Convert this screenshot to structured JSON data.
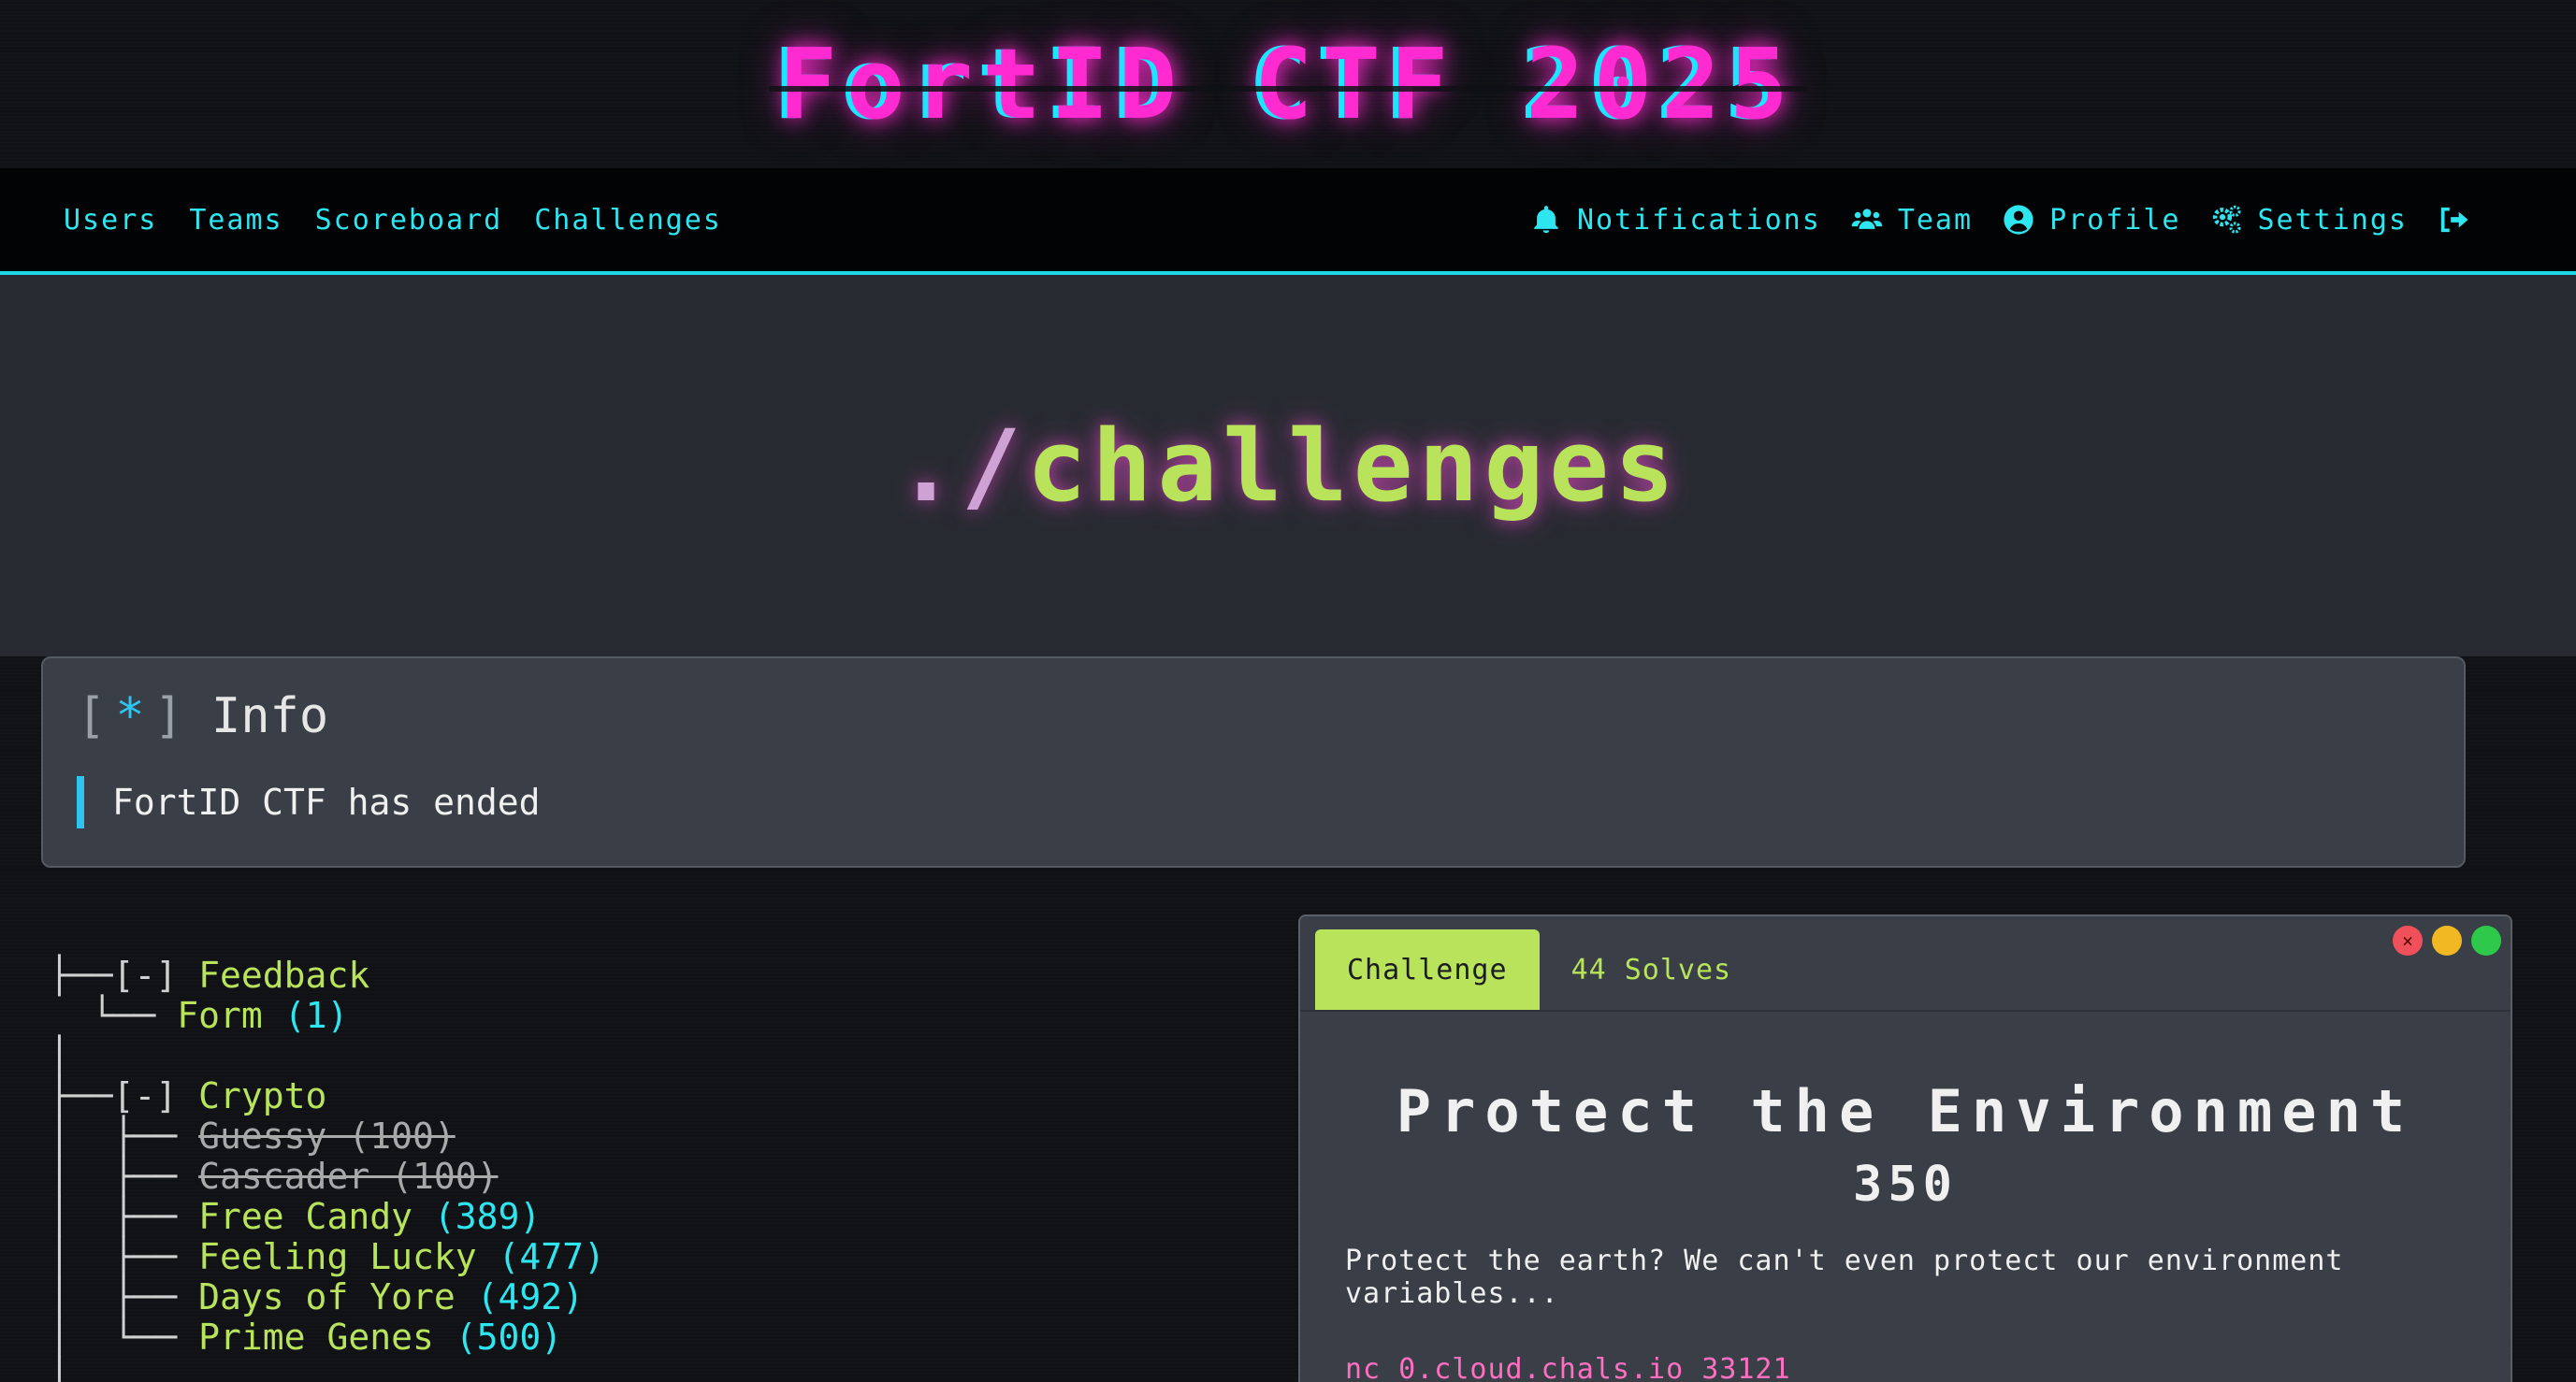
{
  "brand": {
    "title": "FortID CTF 2025"
  },
  "nav": {
    "left": [
      "Users",
      "Teams",
      "Scoreboard",
      "Challenges"
    ],
    "right": [
      {
        "label": "Notifications",
        "icon": "bell-icon"
      },
      {
        "label": "Team",
        "icon": "users-icon"
      },
      {
        "label": "Profile",
        "icon": "user-circle-icon"
      },
      {
        "label": "Settings",
        "icon": "cogs-icon"
      },
      {
        "label": "",
        "icon": "logout-icon"
      }
    ]
  },
  "jumbotron": {
    "prefix": "./",
    "rest": "challenges"
  },
  "info": {
    "bracket_open": "[",
    "star": "*",
    "bracket_close": "]",
    "title": "Info",
    "message": "FortID CTF has ended"
  },
  "tree": {
    "categories": [
      {
        "branch": "├──",
        "toggle": "[-]",
        "name": "Feedback",
        "items": [
          {
            "prefix": "  └── ",
            "name": "Form",
            "points": "(1)",
            "solved": false
          }
        ]
      },
      {
        "branch": "├──",
        "toggle": "[-]",
        "name": "Crypto",
        "items": [
          {
            "prefix": "  ├── ",
            "name": "Guessy (100)",
            "points": "",
            "solved": true
          },
          {
            "prefix": "  ├── ",
            "name": "Cascader (100)",
            "points": "",
            "solved": true
          },
          {
            "prefix": "  ├── ",
            "name": "Free Candy",
            "points": "(389)",
            "solved": false
          },
          {
            "prefix": "  ├── ",
            "name": "Feeling Lucky",
            "points": "(477)",
            "solved": false
          },
          {
            "prefix": "  ├── ",
            "name": "Days of Yore",
            "points": "(492)",
            "solved": false
          },
          {
            "prefix": "  └── ",
            "name": "Prime Genes",
            "points": "(500)",
            "solved": false
          }
        ]
      }
    ]
  },
  "challenge_window": {
    "tabs": {
      "active": "Challenge",
      "solves": "44 Solves"
    },
    "close_glyph": "×",
    "title": "Protect the Environment",
    "value": "350",
    "description": "Protect the earth? We can't even protect our environment variables...",
    "connection": "nc 0.cloud.chals.io 33121"
  },
  "colors": {
    "accent_cyan": "#2ee6f0",
    "accent_green": "#b8e35a",
    "accent_pink": "#ff2bd1",
    "link_pink": "#ff6fc1"
  }
}
